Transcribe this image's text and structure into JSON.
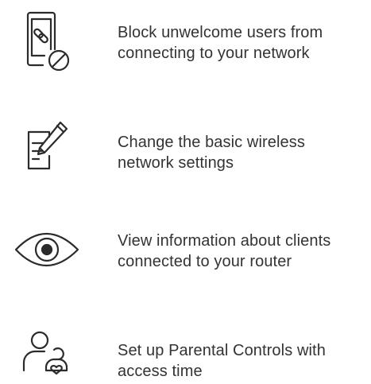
{
  "features": [
    {
      "icon": "blocked-device-icon",
      "lines": [
        "Block unwelcome users from",
        "connecting to your network"
      ]
    },
    {
      "icon": "edit-settings-icon",
      "lines": [
        "Change the basic wireless",
        "network settings"
      ]
    },
    {
      "icon": "eye-icon",
      "lines": [
        "View information about clients",
        "connected to your router"
      ]
    },
    {
      "icon": "parental-controls-icon",
      "lines": [
        "Set up Parental Controls with",
        "access time"
      ]
    }
  ],
  "colors": {
    "icon_stroke": "#2b2b2b",
    "text": "#333333",
    "background": "#ffffff"
  }
}
